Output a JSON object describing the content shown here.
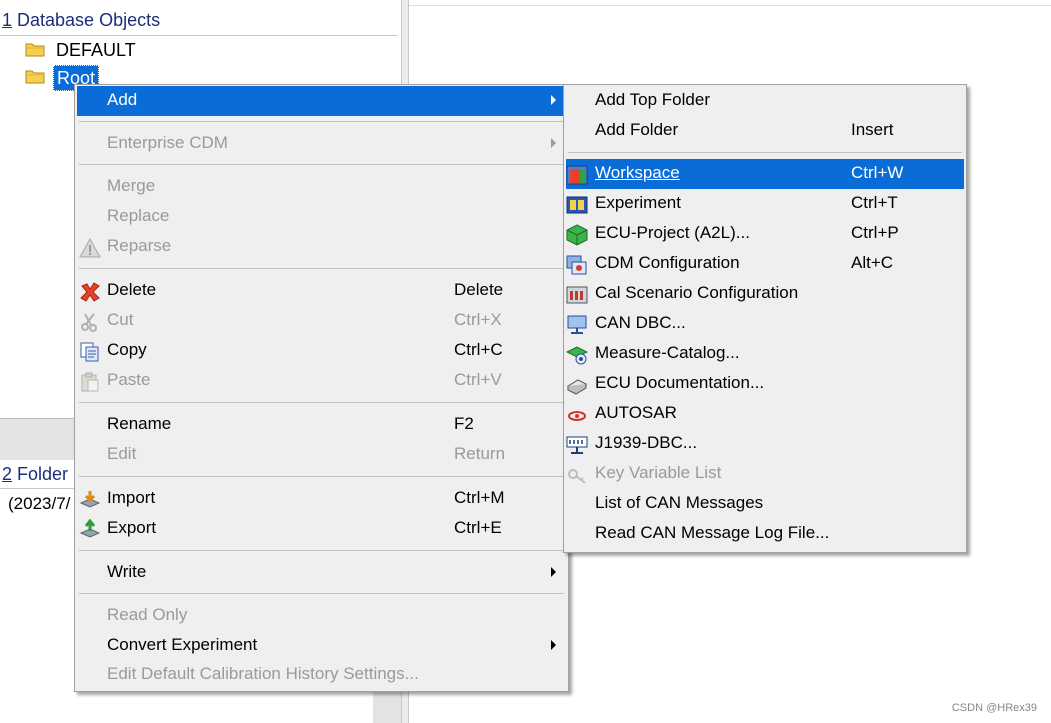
{
  "tree": {
    "header_num": "1",
    "header_text": " Database Objects",
    "nodes": [
      {
        "label": "DEFAULT"
      },
      {
        "label": "Root"
      }
    ]
  },
  "folder": {
    "header_num": "2",
    "header_text": " Folder (",
    "date_text": "(2023/7/"
  },
  "main_menu": {
    "add": "Add",
    "enterprise_cdm": "Enterprise CDM",
    "merge": "Merge",
    "replace": "Replace",
    "reparse": "Reparse",
    "delete": "Delete",
    "delete_sc": "Delete",
    "cut": "Cut",
    "cut_sc": "Ctrl+X",
    "copy": "Copy",
    "copy_sc": "Ctrl+C",
    "paste": "Paste",
    "paste_sc": "Ctrl+V",
    "rename": "Rename",
    "rename_sc": "F2",
    "edit": "Edit",
    "edit_sc": "Return",
    "import": "Import",
    "import_sc": "Ctrl+M",
    "export": "Export",
    "export_sc": "Ctrl+E",
    "write": "Write",
    "read_only": "Read Only",
    "convert_experiment": "Convert Experiment",
    "edit_default_cal": "Edit Default Calibration History Settings..."
  },
  "sub_menu": {
    "add_top_folder": "Add Top Folder",
    "add_folder": "Add Folder",
    "add_folder_sc": "Insert",
    "workspace": "Workspace",
    "workspace_sc": "Ctrl+W",
    "experiment": "Experiment",
    "experiment_sc": "Ctrl+T",
    "ecu_project": "ECU-Project (A2L)...",
    "ecu_project_sc": "Ctrl+P",
    "cdm_config": "CDM Configuration",
    "cdm_config_sc": "Alt+C",
    "cal_scenario": "Cal Scenario Configuration",
    "can_dbc": "CAN DBC...",
    "measure_catalog": "Measure-Catalog...",
    "ecu_documentation": "ECU Documentation...",
    "autosar": "AUTOSAR",
    "j1939": "J1939-DBC...",
    "key_variable_list": "Key Variable List",
    "list_can_messages": "List of CAN Messages",
    "read_can_log": "Read CAN Message Log File..."
  },
  "watermark": "CSDN @HRex39",
  "colors": {
    "highlight": "#0a6cd7",
    "menu_bg": "#efefef",
    "header_blue": "#1a2f7a"
  }
}
